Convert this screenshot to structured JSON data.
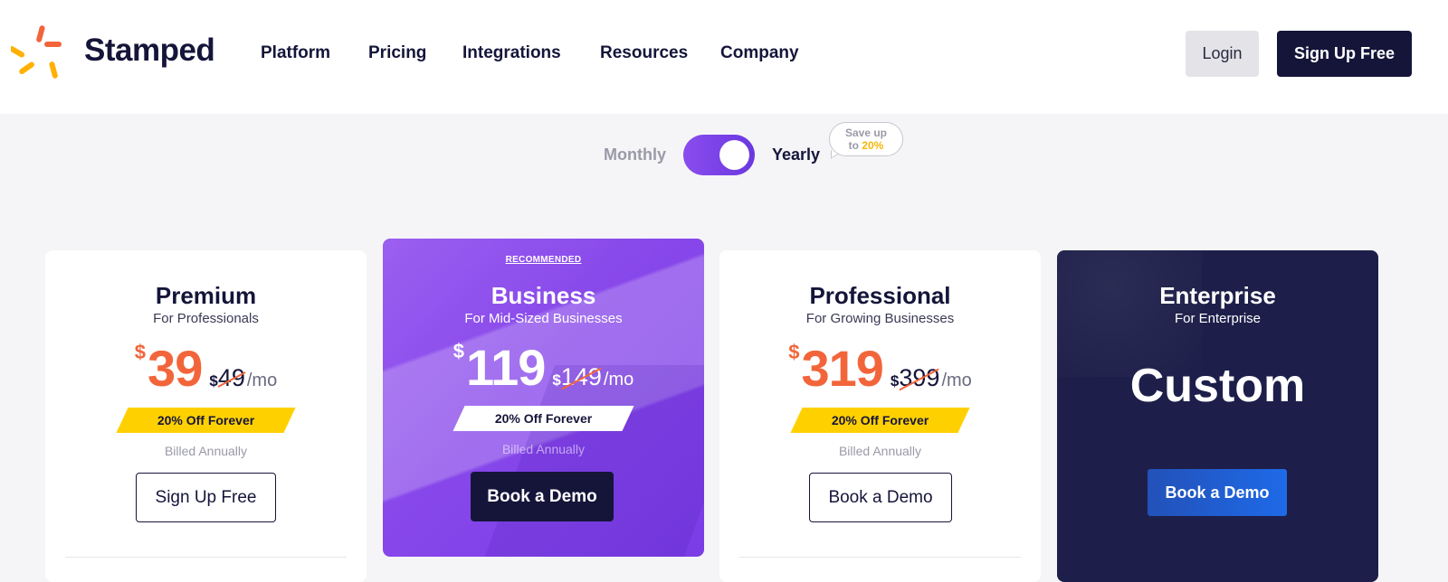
{
  "header": {
    "brand": "Stamped",
    "nav": [
      "Platform",
      "Pricing",
      "Integrations",
      "Resources",
      "Company"
    ],
    "login_label": "Login",
    "signup_label": "Sign Up Free"
  },
  "billing_toggle": {
    "monthly_label": "Monthly",
    "yearly_label": "Yearly",
    "yearly_selected": true,
    "save_text": "Save up",
    "save_to": "to",
    "save_pct": "20%"
  },
  "plans": [
    {
      "name": "Premium",
      "subtitle": "For Professionals",
      "currency": "$",
      "price": "39",
      "old_currency": "$",
      "old_price": "49",
      "period": "/mo",
      "ribbon": "20% Off Forever",
      "billed": "Billed Annually",
      "cta": "Sign Up Free"
    },
    {
      "badge": "RECOMMENDED",
      "name": "Business",
      "subtitle": "For Mid-Sized Businesses",
      "currency": "$",
      "price": "119",
      "old_currency": "$",
      "old_price": "149",
      "period": "/mo",
      "ribbon": "20% Off Forever",
      "billed": "Billed Annually",
      "cta": "Book a Demo"
    },
    {
      "name": "Professional",
      "subtitle": "For Growing Businesses",
      "currency": "$",
      "price": "319",
      "old_currency": "$",
      "old_price": "399",
      "period": "/mo",
      "ribbon": "20% Off Forever",
      "billed": "Billed Annually",
      "cta": "Book a Demo"
    },
    {
      "name": "Enterprise",
      "subtitle": "For Enterprise",
      "price_text": "Custom",
      "cta": "Book a Demo"
    }
  ],
  "colors": {
    "brand_navy": "#15153a",
    "accent_orange": "#f2653a",
    "ribbon_yellow": "#ffd000",
    "business_purple": "#8747ea",
    "enterprise_navy": "#1d1f4a",
    "enterprise_button": "#1e6ae8"
  }
}
